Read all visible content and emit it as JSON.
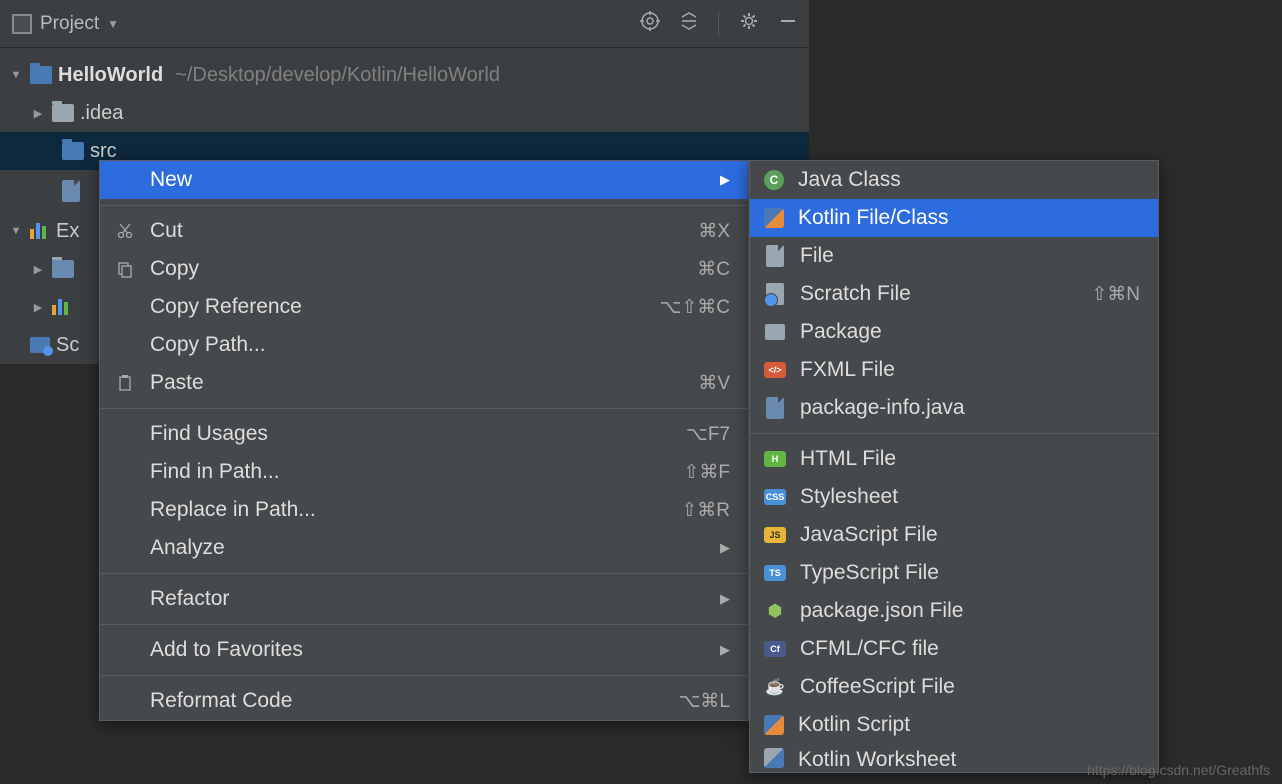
{
  "topbar": {
    "project_label": "Project"
  },
  "tree": {
    "root_name": "HelloWorld",
    "root_path": "~/Desktop/develop/Kotlin/HelloWorld",
    "idea": ".idea",
    "src": "src",
    "ext_libs": "Ex",
    "scratches": "Sc"
  },
  "context_menu": {
    "new": "New",
    "cut": {
      "label": "Cut",
      "shortcut": "⌘X"
    },
    "copy": {
      "label": "Copy",
      "shortcut": "⌘C"
    },
    "copy_reference": {
      "label": "Copy Reference",
      "shortcut": "⌥⇧⌘C"
    },
    "copy_path": {
      "label": "Copy Path..."
    },
    "paste": {
      "label": "Paste",
      "shortcut": "⌘V"
    },
    "find_usages": {
      "label": "Find Usages",
      "shortcut": "⌥F7"
    },
    "find_in_path": {
      "label": "Find in Path...",
      "shortcut": "⇧⌘F"
    },
    "replace_in_path": {
      "label": "Replace in Path...",
      "shortcut": "⇧⌘R"
    },
    "analyze": {
      "label": "Analyze"
    },
    "refactor": {
      "label": "Refactor"
    },
    "add_to_favorites": {
      "label": "Add to Favorites"
    },
    "reformat_code": {
      "label": "Reformat Code",
      "shortcut": "⌥⌘L"
    }
  },
  "submenu": {
    "java_class": "Java Class",
    "kotlin_file_class": "Kotlin File/Class",
    "file": "File",
    "scratch_file": {
      "label": "Scratch File",
      "shortcut": "⇧⌘N"
    },
    "package": "Package",
    "fxml_file": "FXML File",
    "package_info": "package-info.java",
    "html_file": "HTML File",
    "stylesheet": "Stylesheet",
    "javascript_file": "JavaScript File",
    "typescript_file": "TypeScript File",
    "package_json": "package.json File",
    "cfml_file": "CFML/CFC file",
    "coffeescript_file": "CoffeeScript File",
    "kotlin_script": "Kotlin Script",
    "kotlin_worksheet": "Kotlin Worksheet"
  },
  "watermark": "https://blog.csdn.net/Greathfs"
}
